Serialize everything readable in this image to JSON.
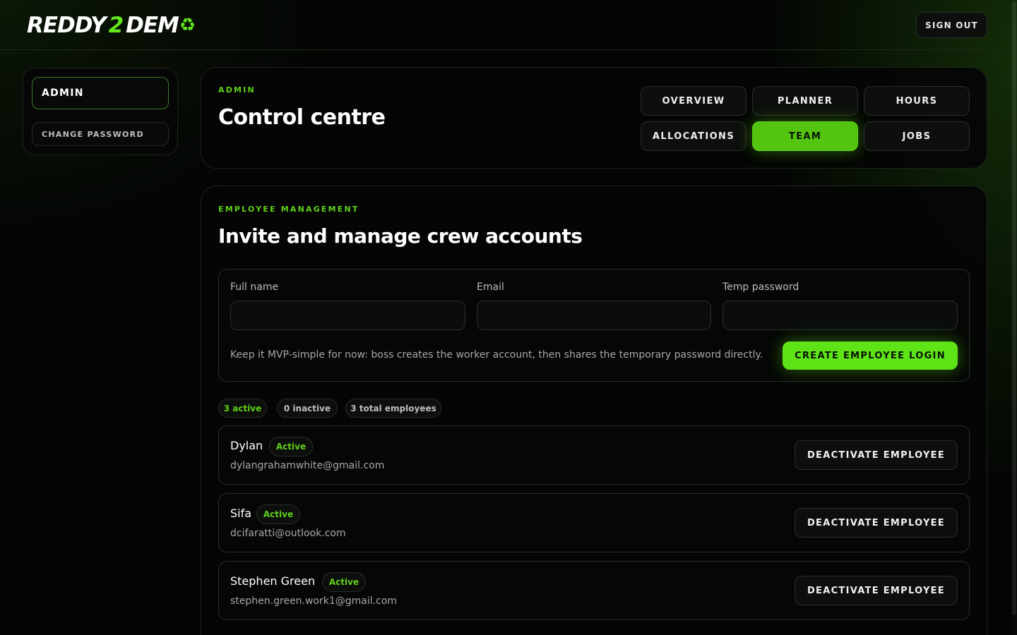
{
  "brand": {
    "logo_left": "REDDY",
    "logo_two": "2",
    "logo_right": "DEM",
    "logo_icon": "recycle-icon",
    "accent_color": "#5ee317"
  },
  "header": {
    "signout_label": "SIGN OUT"
  },
  "sidebar": {
    "items": [
      {
        "label": "ADMIN",
        "active": true
      },
      {
        "label": "CHANGE PASSWORD",
        "active": false
      }
    ]
  },
  "control": {
    "eyebrow": "ADMIN",
    "title": "Control centre",
    "tabs": [
      {
        "label": "OVERVIEW",
        "active": false
      },
      {
        "label": "PLANNER",
        "active": false
      },
      {
        "label": "HOURS",
        "active": false
      },
      {
        "label": "ALLOCATIONS",
        "active": false
      },
      {
        "label": "TEAM",
        "active": true
      },
      {
        "label": "JOBS",
        "active": false
      }
    ]
  },
  "employees": {
    "eyebrow": "EMPLOYEE MANAGEMENT",
    "title": "Invite and manage crew accounts",
    "form": {
      "fullname_label": "Full name",
      "fullname_value": "",
      "email_label": "Email",
      "email_value": "",
      "temp_password_label": "Temp password",
      "temp_password_value": "",
      "hint": "Keep it MVP-simple for now: boss creates the worker account, then shares the temporary password directly.",
      "create_label": "CREATE EMPLOYEE LOGIN"
    },
    "stats": {
      "active": "3 active",
      "inactive": "0 inactive",
      "total": "3 total employees"
    },
    "list": [
      {
        "name": "Dylan",
        "status": "Active",
        "email": "dylangrahamwhite@gmail.com",
        "action": "DEACTIVATE EMPLOYEE"
      },
      {
        "name": "Sifa",
        "status": "Active",
        "email": "dcifaratti@outlook.com",
        "action": "DEACTIVATE EMPLOYEE"
      },
      {
        "name": "Stephen Green",
        "status": "Active",
        "email": "stephen.green.work1@gmail.com",
        "action": "DEACTIVATE EMPLOYEE"
      }
    ]
  }
}
